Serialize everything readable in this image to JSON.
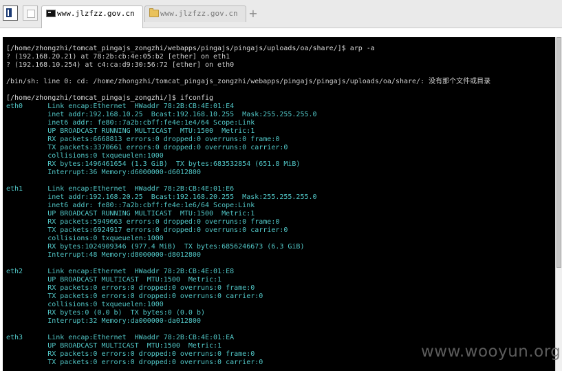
{
  "tabs": [
    {
      "label": "www.jlzfzz.gov.cn",
      "icon": "terminal-icon",
      "active": true
    },
    {
      "label": "www.jlzfzz.gov.cn",
      "icon": "folder-icon",
      "active": false
    }
  ],
  "new_tab_symbol": "+",
  "terminal": {
    "lines": [
      {
        "text": "[/home/zhongzhi/tomcat_pingajs_zongzhi/webapps/pingajs/pingajs/uploads/oa/share/]$ arp -a",
        "kind": "prompt"
      },
      {
        "text": "? (192.168.20.21) at 78:2b:cb:4e:05:b2 [ether] on eth1",
        "kind": "out"
      },
      {
        "text": "? (192.168.10.254) at c4:ca:d9:30:56:72 [ether] on eth0",
        "kind": "out"
      },
      {
        "text": "",
        "kind": "out"
      },
      {
        "text": "/bin/sh: line 0: cd: /home/zhongzhi/tomcat_pingajs_zongzhi/webapps/pingajs/pingajs/uploads/oa/share/: 没有那个文件或目录",
        "kind": "out"
      },
      {
        "text": "",
        "kind": "out"
      },
      {
        "text": "[/home/zhongzhi/tomcat_pingajs_zongzhi/]$ ifconfig",
        "kind": "prompt"
      },
      {
        "text": "eth0      Link encap:Ethernet  HWaddr 78:2B:CB:4E:01:E4",
        "kind": "detail"
      },
      {
        "text": "          inet addr:192.168.10.25  Bcast:192.168.10.255  Mask:255.255.255.0",
        "kind": "detail"
      },
      {
        "text": "          inet6 addr: fe80::7a2b:cbff:fe4e:1e4/64 Scope:Link",
        "kind": "detail"
      },
      {
        "text": "          UP BROADCAST RUNNING MULTICAST  MTU:1500  Metric:1",
        "kind": "detail"
      },
      {
        "text": "          RX packets:6668813 errors:0 dropped:0 overruns:0 frame:0",
        "kind": "detail"
      },
      {
        "text": "          TX packets:3370661 errors:0 dropped:0 overruns:0 carrier:0",
        "kind": "detail"
      },
      {
        "text": "          collisions:0 txqueuelen:1000",
        "kind": "detail"
      },
      {
        "text": "          RX bytes:1496461654 (1.3 GiB)  TX bytes:683532854 (651.8 MiB)",
        "kind": "detail"
      },
      {
        "text": "          Interrupt:36 Memory:d6000000-d6012800",
        "kind": "detail"
      },
      {
        "text": "",
        "kind": "out"
      },
      {
        "text": "eth1      Link encap:Ethernet  HWaddr 78:2B:CB:4E:01:E6",
        "kind": "detail"
      },
      {
        "text": "          inet addr:192.168.20.25  Bcast:192.168.20.255  Mask:255.255.255.0",
        "kind": "detail"
      },
      {
        "text": "          inet6 addr: fe80::7a2b:cbff:fe4e:1e6/64 Scope:Link",
        "kind": "detail"
      },
      {
        "text": "          UP BROADCAST RUNNING MULTICAST  MTU:1500  Metric:1",
        "kind": "detail"
      },
      {
        "text": "          RX packets:5949663 errors:0 dropped:0 overruns:0 frame:0",
        "kind": "detail"
      },
      {
        "text": "          TX packets:6924917 errors:0 dropped:0 overruns:0 carrier:0",
        "kind": "detail"
      },
      {
        "text": "          collisions:0 txqueuelen:1000",
        "kind": "detail"
      },
      {
        "text": "          RX bytes:1024909346 (977.4 MiB)  TX bytes:6856246673 (6.3 GiB)",
        "kind": "detail"
      },
      {
        "text": "          Interrupt:48 Memory:d8000000-d8012800",
        "kind": "detail"
      },
      {
        "text": "",
        "kind": "out"
      },
      {
        "text": "eth2      Link encap:Ethernet  HWaddr 78:2B:CB:4E:01:E8",
        "kind": "detail"
      },
      {
        "text": "          UP BROADCAST MULTICAST  MTU:1500  Metric:1",
        "kind": "detail"
      },
      {
        "text": "          RX packets:0 errors:0 dropped:0 overruns:0 frame:0",
        "kind": "detail"
      },
      {
        "text": "          TX packets:0 errors:0 dropped:0 overruns:0 carrier:0",
        "kind": "detail"
      },
      {
        "text": "          collisions:0 txqueuelen:1000",
        "kind": "detail"
      },
      {
        "text": "          RX bytes:0 (0.0 b)  TX bytes:0 (0.0 b)",
        "kind": "detail"
      },
      {
        "text": "          Interrupt:32 Memory:da000000-da012800",
        "kind": "detail"
      },
      {
        "text": "",
        "kind": "out"
      },
      {
        "text": "eth3      Link encap:Ethernet  HWaddr 78:2B:CB:4E:01:EA",
        "kind": "detail"
      },
      {
        "text": "          UP BROADCAST MULTICAST  MTU:1500  Metric:1",
        "kind": "detail"
      },
      {
        "text": "          RX packets:0 errors:0 dropped:0 overruns:0 frame:0",
        "kind": "detail"
      },
      {
        "text": "          TX packets:0 errors:0 dropped:0 overruns:0 carrier:0",
        "kind": "detail"
      }
    ]
  },
  "watermark": "www.wooyun.org",
  "colors": {
    "terminal_bg": "#000000",
    "prompt_text": "#d8d8d8",
    "detail_text": "#52c8c8"
  }
}
